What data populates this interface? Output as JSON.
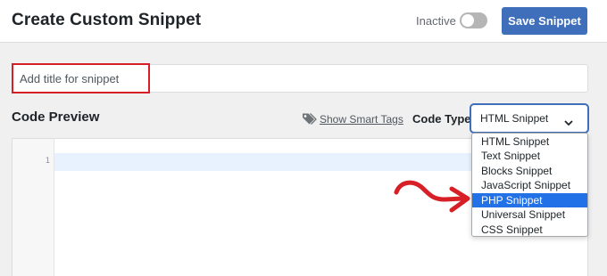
{
  "header": {
    "title": "Create Custom Snippet",
    "status_label": "Inactive",
    "toggle_active": false,
    "save_label": "Save Snippet"
  },
  "title_input": {
    "value": "",
    "placeholder": "Add title for snippet"
  },
  "code_preview": {
    "heading": "Code Preview",
    "smart_tags_icon": "tag-icon",
    "smart_tags_label": "Show Smart Tags",
    "code_type_label": "Code Type",
    "selected_value": "HTML Snippet",
    "line_numbers": [
      "1"
    ]
  },
  "dropdown": {
    "options": [
      "HTML Snippet",
      "Text Snippet",
      "Blocks Snippet",
      "JavaScript Snippet",
      "PHP Snippet",
      "Universal Snippet",
      "CSS Snippet"
    ],
    "highlighted": "PHP Snippet"
  },
  "colors": {
    "accent": "#3f6fba",
    "highlight_option": "#2271e6",
    "annotation_red": "#d61f26"
  }
}
